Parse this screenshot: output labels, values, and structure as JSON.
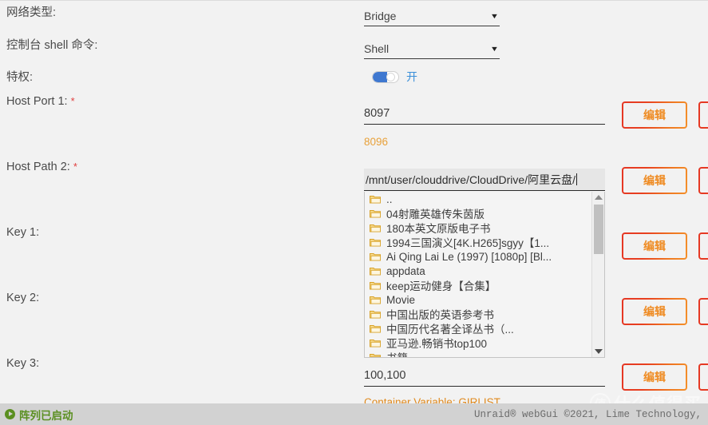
{
  "form": {
    "fields": [
      {
        "label": "网络类型:",
        "required": false
      },
      {
        "label": "控制台 shell 命令:",
        "required": false
      },
      {
        "label": "特权:",
        "required": false
      },
      {
        "label": "Host Port 1:",
        "required": true
      },
      {
        "label": "Host Path 2:",
        "required": true
      },
      {
        "label": "Key 1:",
        "required": false
      },
      {
        "label": "Key 2:",
        "required": false
      },
      {
        "label": "Key 3:",
        "required": false
      }
    ],
    "network_type": {
      "value": "Bridge",
      "caret": "chevron-down-icon"
    },
    "console_shell": {
      "value": "Shell",
      "caret": "chevron-down-icon"
    },
    "privileged": {
      "state": "on",
      "label": "开"
    },
    "host_port_1": {
      "value": "8097",
      "hint": "8096"
    },
    "host_path_2": {
      "value": "/mnt/user/clouddrive/CloudDrive/阿里云盘/"
    },
    "key_3": {
      "value": "100,100",
      "hint": "Container Variable: GIRLIST"
    },
    "edit_button_label": "编辑"
  },
  "file_browser": {
    "items": [
      "..",
      "04射雕英雄传朱茵版",
      "180本英文原版电子书",
      "1994三国演义[4K.H265]sgyy【1...",
      "Ai Qing Lai Le (1997) [1080p] [Bl...",
      "appdata",
      "keep运动健身【合集】",
      "Movie",
      "中国出版的英语参考书",
      "中国历代名著全译丛书（...",
      "亚马逊.畅销书top100",
      "书籍"
    ],
    "scroll_up_icon": "triangle-up-icon",
    "scroll_down_icon": "triangle-down-icon"
  },
  "footer": {
    "array_status": "阵列已启动",
    "array_icon": "play-circle-icon",
    "copyright": "Unraid® webGui ©2021, Lime Technology,"
  },
  "watermark": {
    "mark": "值",
    "text": "什么值得买"
  },
  "colors": {
    "accent_orange": "#ef8b22",
    "accent_red": "#e53725",
    "toggle_blue": "#3f78d0",
    "status_green": "#5a8f20",
    "hint_orange": "#e8a13a"
  }
}
